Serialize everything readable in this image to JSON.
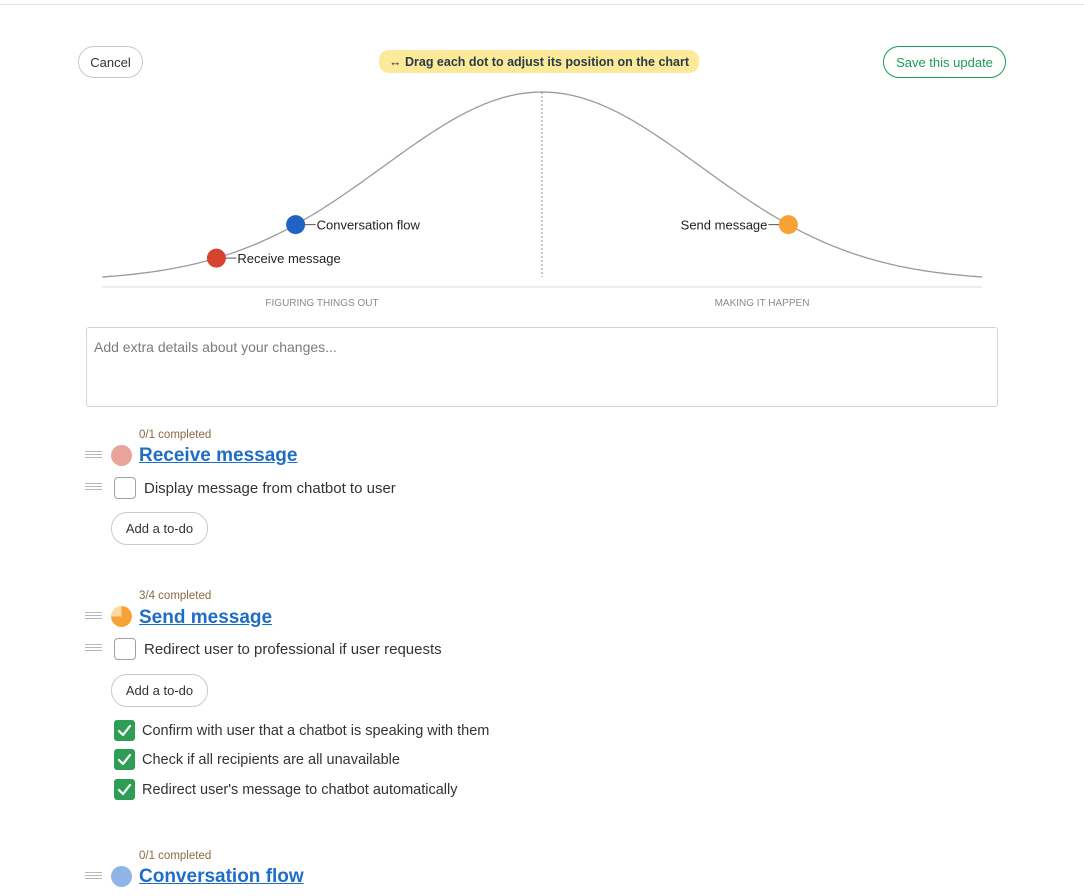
{
  "header": {
    "cancel_label": "Cancel",
    "drag_hint": "↔ Drag each dot to adjust its position on the chart",
    "save_label": "Save this update"
  },
  "hill_chart": {
    "left_label": "FIGURING THINGS OUT",
    "right_label": "MAKING IT HAPPEN",
    "dots": [
      {
        "label": "Receive message",
        "progress": 0.13,
        "color": "#d6442e",
        "label_side": "right"
      },
      {
        "label": "Conversation flow",
        "progress": 0.22,
        "color": "#1f64c4",
        "label_side": "right"
      },
      {
        "label": "Send message",
        "progress": 0.78,
        "color": "#f7a234",
        "label_side": "left"
      }
    ]
  },
  "details": {
    "placeholder": "Add extra details about your changes..."
  },
  "scopes": [
    {
      "count": "0/1 completed",
      "title": "Receive message",
      "dot_color": "#e8a39a",
      "open_todos": [
        "Display message from chatbot to user"
      ],
      "add_todo_label": "Add a to-do",
      "completed_todos": []
    },
    {
      "count": "3/4 completed",
      "title": "Send message",
      "dot_color": "#f7a234",
      "completion": 0.75,
      "open_todos": [
        "Redirect user to professional if user requests"
      ],
      "add_todo_label": "Add a to-do",
      "completed_todos": [
        "Confirm with user that a chatbot is speaking with them",
        "Check if all recipients are all unavailable",
        "Redirect user's message to chatbot automatically"
      ]
    },
    {
      "count": "0/1 completed",
      "title": "Conversation flow",
      "dot_color": "#8fb4e6"
    }
  ]
}
